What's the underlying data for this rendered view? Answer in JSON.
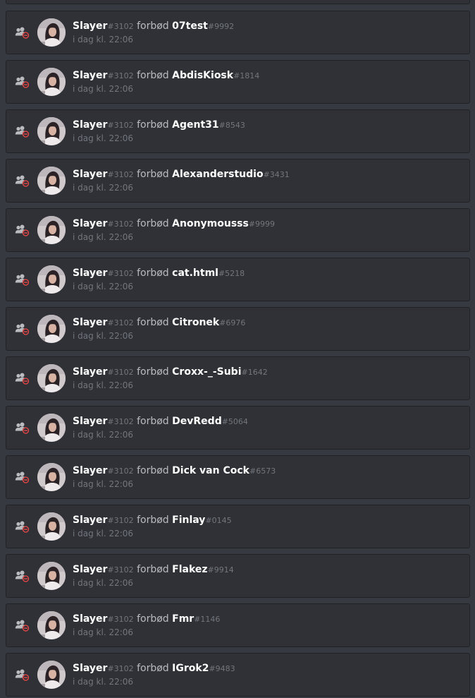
{
  "actor": {
    "name": "Slayer",
    "discriminator": "#3102"
  },
  "action_label": "forbød",
  "timestamp": "i dag kl. 22:06",
  "colors": {
    "background": "#36393f",
    "card": "#2f3136",
    "ban_icon_red": "#f04747"
  },
  "entries": [
    {
      "target_name": "07test",
      "target_disc": "#9992"
    },
    {
      "target_name": "AbdisKiosk",
      "target_disc": "#1814"
    },
    {
      "target_name": "Agent31",
      "target_disc": "#8543"
    },
    {
      "target_name": "Alexanderstudio",
      "target_disc": "#3431"
    },
    {
      "target_name": "Anonymousss",
      "target_disc": "#9999"
    },
    {
      "target_name": "cat.html",
      "target_disc": "#5218"
    },
    {
      "target_name": "Citronek",
      "target_disc": "#6976"
    },
    {
      "target_name": "Croxx-_-Subi",
      "target_disc": "#1642"
    },
    {
      "target_name": "DevRedd",
      "target_disc": "#5064"
    },
    {
      "target_name": "Dick van Cock",
      "target_disc": "#6573"
    },
    {
      "target_name": "Finlay",
      "target_disc": "#0145"
    },
    {
      "target_name": "Flakez",
      "target_disc": "#9914"
    },
    {
      "target_name": "Fmr",
      "target_disc": "#1146"
    },
    {
      "target_name": "IGrok2",
      "target_disc": "#9483"
    }
  ]
}
